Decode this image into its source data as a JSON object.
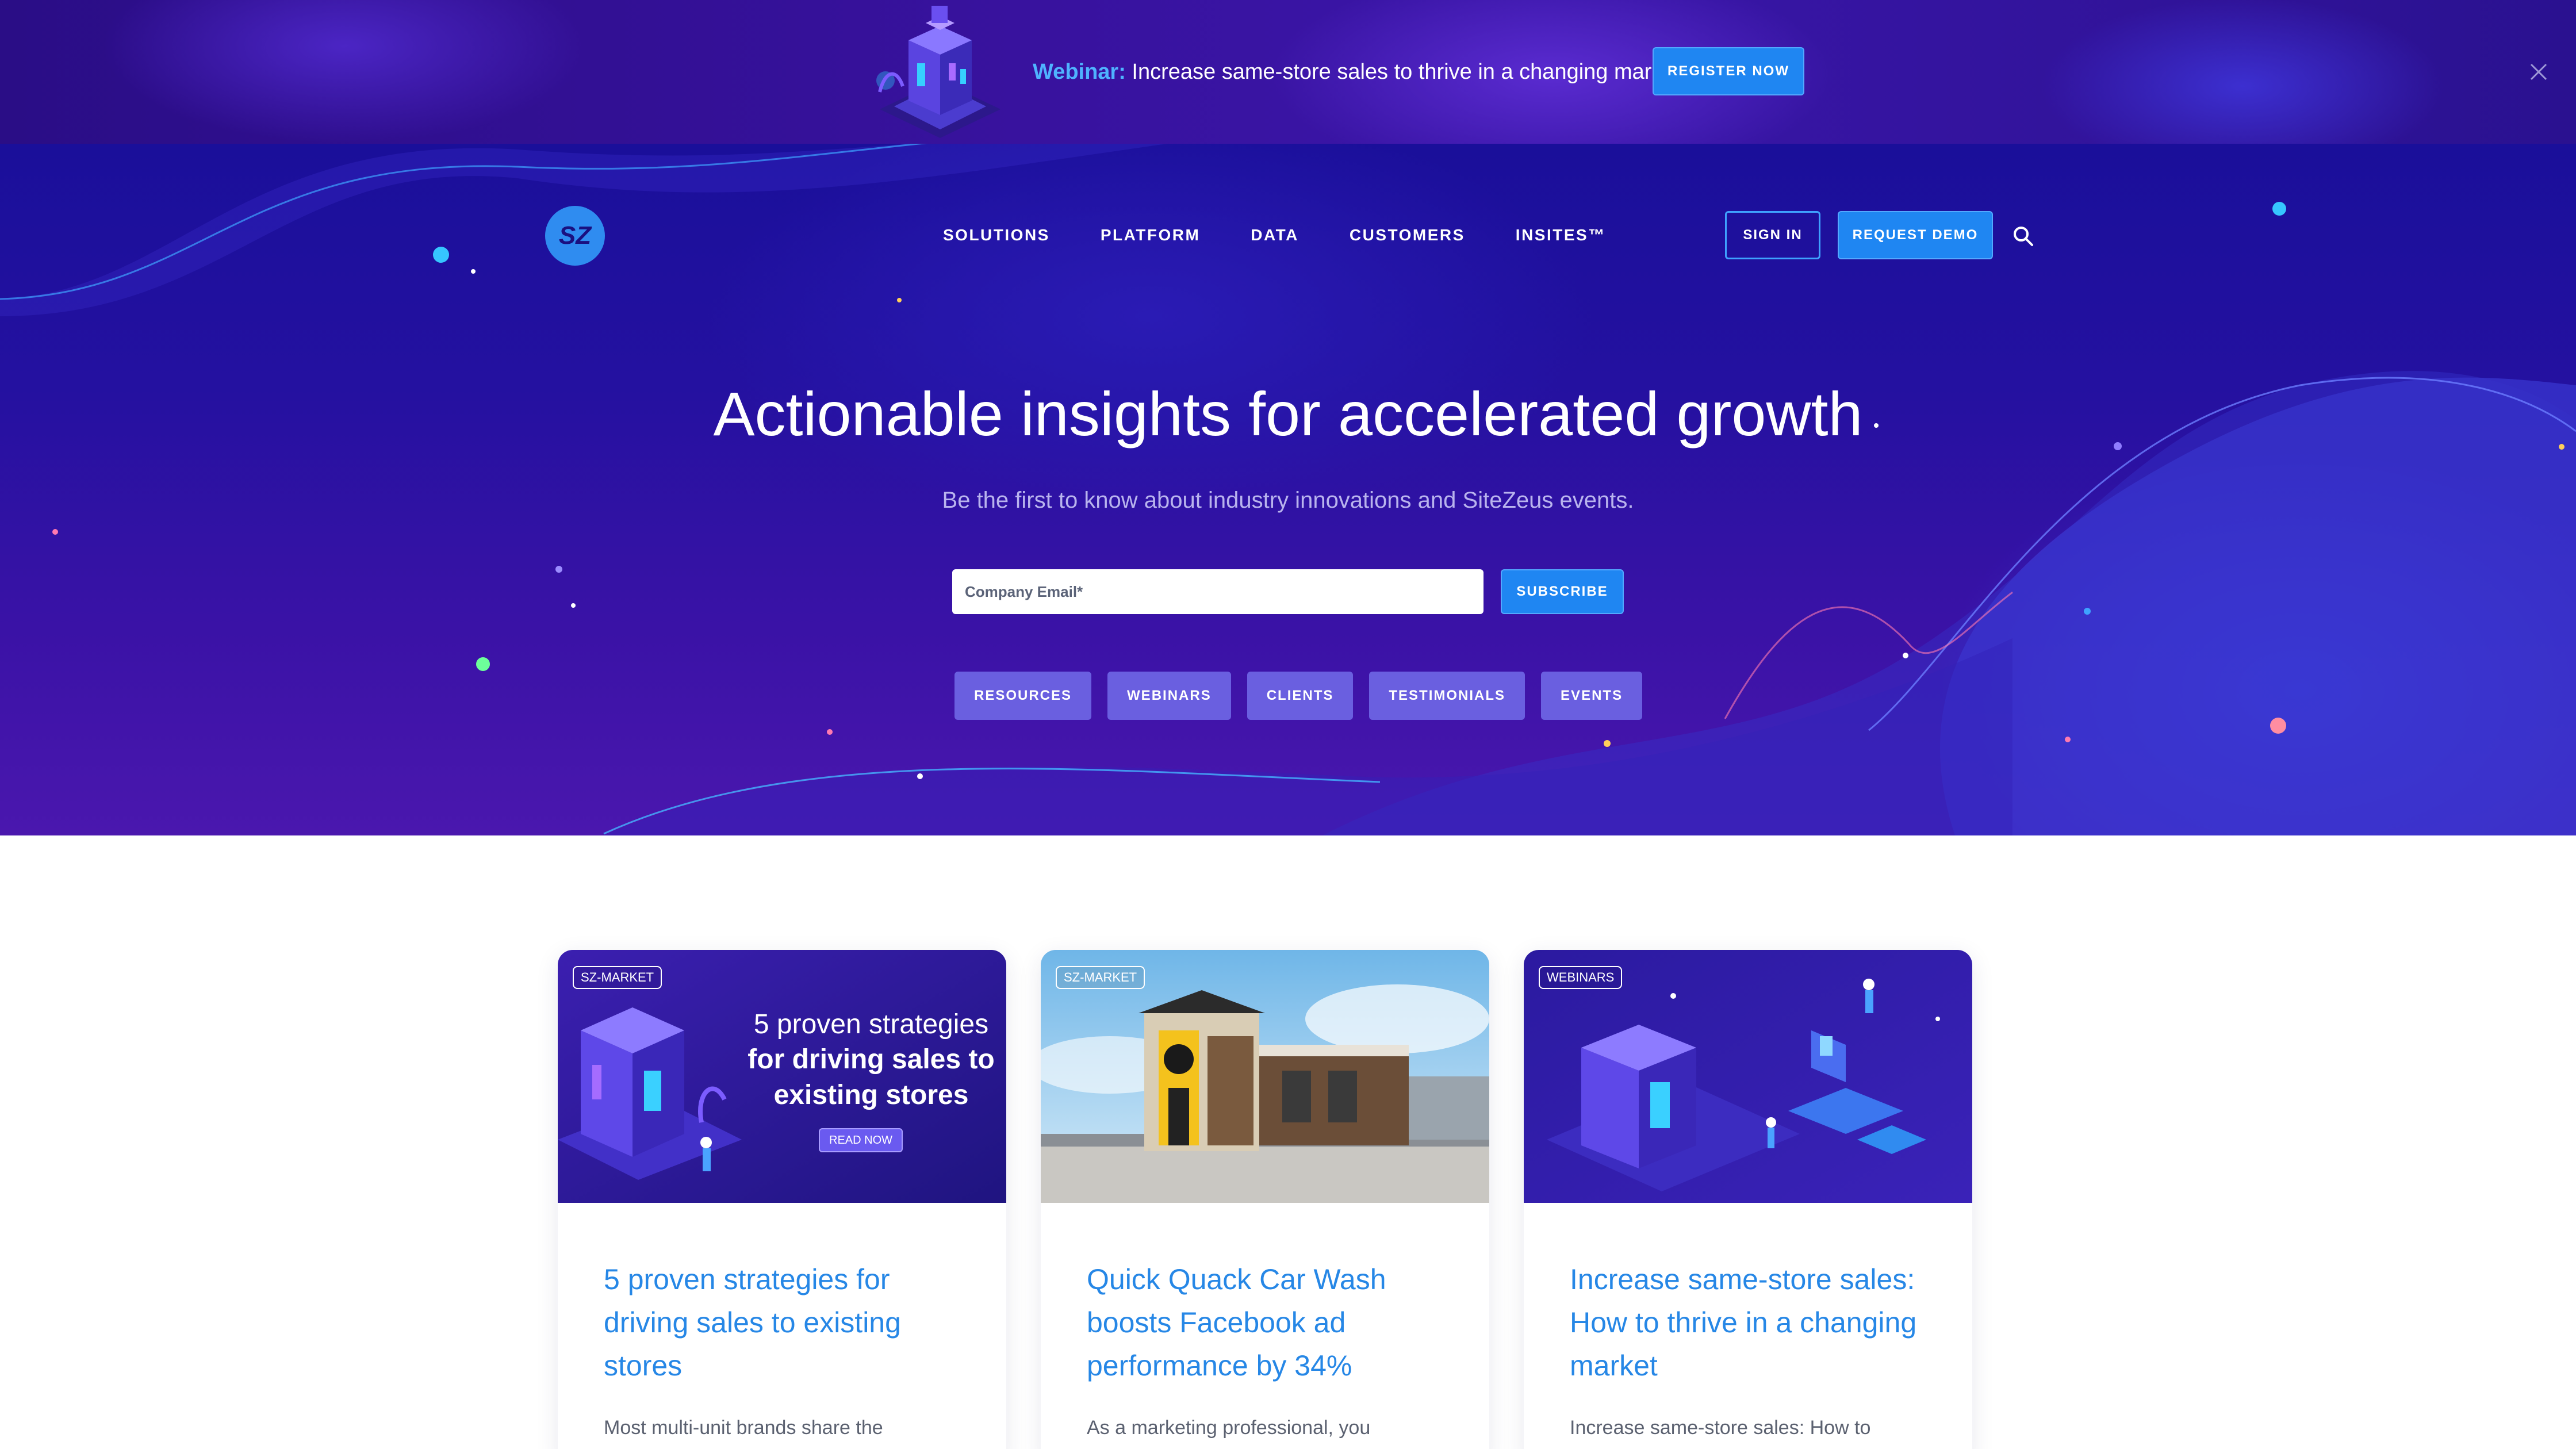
{
  "announcement": {
    "lead": "Webinar:",
    "text": " Increase same-store sales to thrive in a changing market",
    "button": "REGISTER NOW",
    "close_icon": "close-icon"
  },
  "header": {
    "logo_text": "SZ",
    "nav": [
      "SOLUTIONS",
      "PLATFORM",
      "DATA",
      "CUSTOMERS",
      "INSITES™"
    ],
    "sign_in": "SIGN IN",
    "request_demo": "REQUEST DEMO",
    "search_icon": "search-icon"
  },
  "hero": {
    "title": "Actionable insights for accelerated growth",
    "subtitle": "Be the first to know about industry innovations and SiteZeus events.",
    "email_placeholder": "Company Email*",
    "subscribe": "SUBSCRIBE",
    "filters": [
      "RESOURCES",
      "WEBINARS",
      "CLIENTS",
      "TESTIMONIALS",
      "EVENTS"
    ]
  },
  "cards": [
    {
      "tag": "SZ-MARKET",
      "image_line1": "5 proven strategies",
      "image_line2": "for driving sales to",
      "image_line3": "existing stores",
      "image_button": "READ NOW",
      "title": "5 proven strategies for driving sales to existing stores",
      "excerpt": "Most multi-unit brands share the"
    },
    {
      "tag": "SZ-MARKET",
      "title": "Quick Quack Car Wash boosts Facebook ad performance by 34%",
      "excerpt": "As a marketing professional, you"
    },
    {
      "tag": "WEBINARS",
      "title": "Increase same-store sales: How to thrive in a changing market",
      "excerpt": "Increase same-store sales: How to"
    }
  ],
  "colors": {
    "accent_blue": "#1f86f2",
    "link_blue": "#2687e6",
    "hero_purple": "#2411a0",
    "pill_purple": "#6a5fe0"
  }
}
